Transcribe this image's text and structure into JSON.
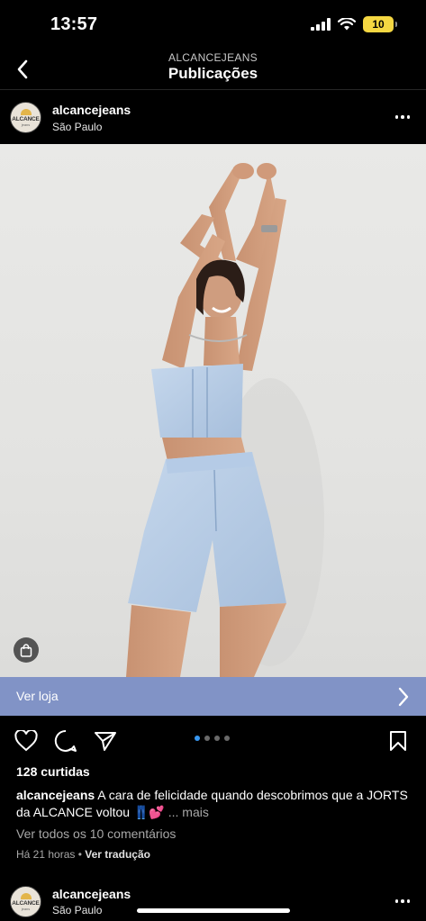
{
  "status": {
    "time": "13:57",
    "battery": "10"
  },
  "header": {
    "account": "ALCANCEJEANS",
    "title": "Publicações"
  },
  "post": {
    "avatar_brand": "ALCANCE",
    "avatar_sub": "jeans",
    "username": "alcancejeans",
    "location": "São Paulo"
  },
  "shop": {
    "label": "Ver loja"
  },
  "carousel": {
    "total": 4,
    "active": 0
  },
  "likes": "128 curtidas",
  "caption": {
    "username": "alcancejeans",
    "text": "A cara de felicidade quando descobrimos que a JORTS da ALCANCE voltou 👖💕",
    "more": "... mais"
  },
  "comments_link": "Ver todos os 10 comentários",
  "meta": {
    "time": "Há 21 horas",
    "separator": " • ",
    "translate": "Ver tradução"
  },
  "next_post": {
    "username": "alcancejeans",
    "location": "São Paulo"
  },
  "colors": {
    "shop_bar": "#8193c6",
    "dot_active": "#3897f0",
    "battery": "#f5d742"
  },
  "icons": [
    "back-icon",
    "more-icon",
    "shopping-bag-icon",
    "chevron-right-icon",
    "heart-icon",
    "comment-icon",
    "share-icon",
    "bookmark-icon"
  ]
}
